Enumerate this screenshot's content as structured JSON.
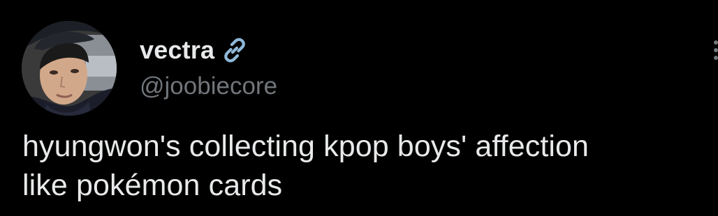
{
  "tweet": {
    "author": {
      "display_name": "vectra",
      "handle": "@joobiecore",
      "avatar_icon": "profile-photo",
      "badge_icon": "link-icon"
    },
    "text": "hyungwon's collecting kpop boys' affection\nlike pokémon cards",
    "more_icon": "more-options-icon"
  },
  "colors": {
    "background": "#000000",
    "primary_text": "#e7e9ea",
    "secondary_text": "#71767b",
    "link_icon": "#8fb8d8"
  }
}
